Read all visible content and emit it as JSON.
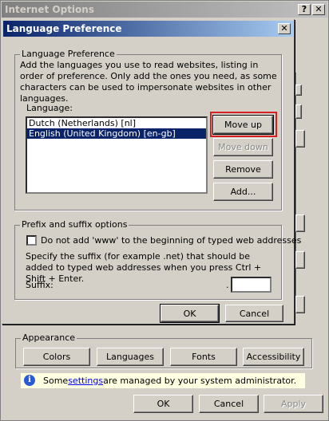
{
  "internet_options": {
    "title": "Internet Options",
    "help_glyph": "?",
    "close_glyph": "✕",
    "appearance": {
      "label": "Appearance",
      "buttons": [
        "Colors",
        "Languages",
        "Fonts",
        "Accessibility"
      ]
    },
    "info": {
      "prefix": "Some ",
      "link": "settings",
      "suffix": " are managed by your system administrator."
    },
    "bottom_buttons": {
      "ok": "OK",
      "cancel": "Cancel",
      "apply": "Apply"
    }
  },
  "language_dialog": {
    "title": "Language Preference",
    "close_glyph": "✕",
    "group_label": "Language Preference",
    "description": "Add the languages you use to read websites, listing in order of preference. Only add the ones you need, as some characters can be used to impersonate websites in other languages.",
    "language_label": "Language:",
    "languages": [
      {
        "label": "Dutch (Netherlands) [nl]",
        "selected": false
      },
      {
        "label": "English (United Kingdom) [en-gb]",
        "selected": true
      }
    ],
    "buttons": {
      "move_up": "Move up",
      "move_down": "Move down",
      "remove": "Remove",
      "add": "Add..."
    },
    "prefix_suffix": {
      "label": "Prefix and suffix options",
      "checkbox_label": "Do not add 'www' to the beginning of typed web addresses",
      "checkbox_checked": false,
      "specify_text": "Specify the suffix (for example .net) that should be added to typed web addresses when you press Ctrl + Shift + Enter.",
      "suffix_label": "Suffix:",
      "suffix_prefix_dot": ".",
      "suffix_value": ""
    },
    "ok": "OK",
    "cancel": "Cancel"
  },
  "colors": {
    "highlight_box": "#d42020",
    "selection": "#0a246a",
    "info_background": "#ffffe1"
  }
}
